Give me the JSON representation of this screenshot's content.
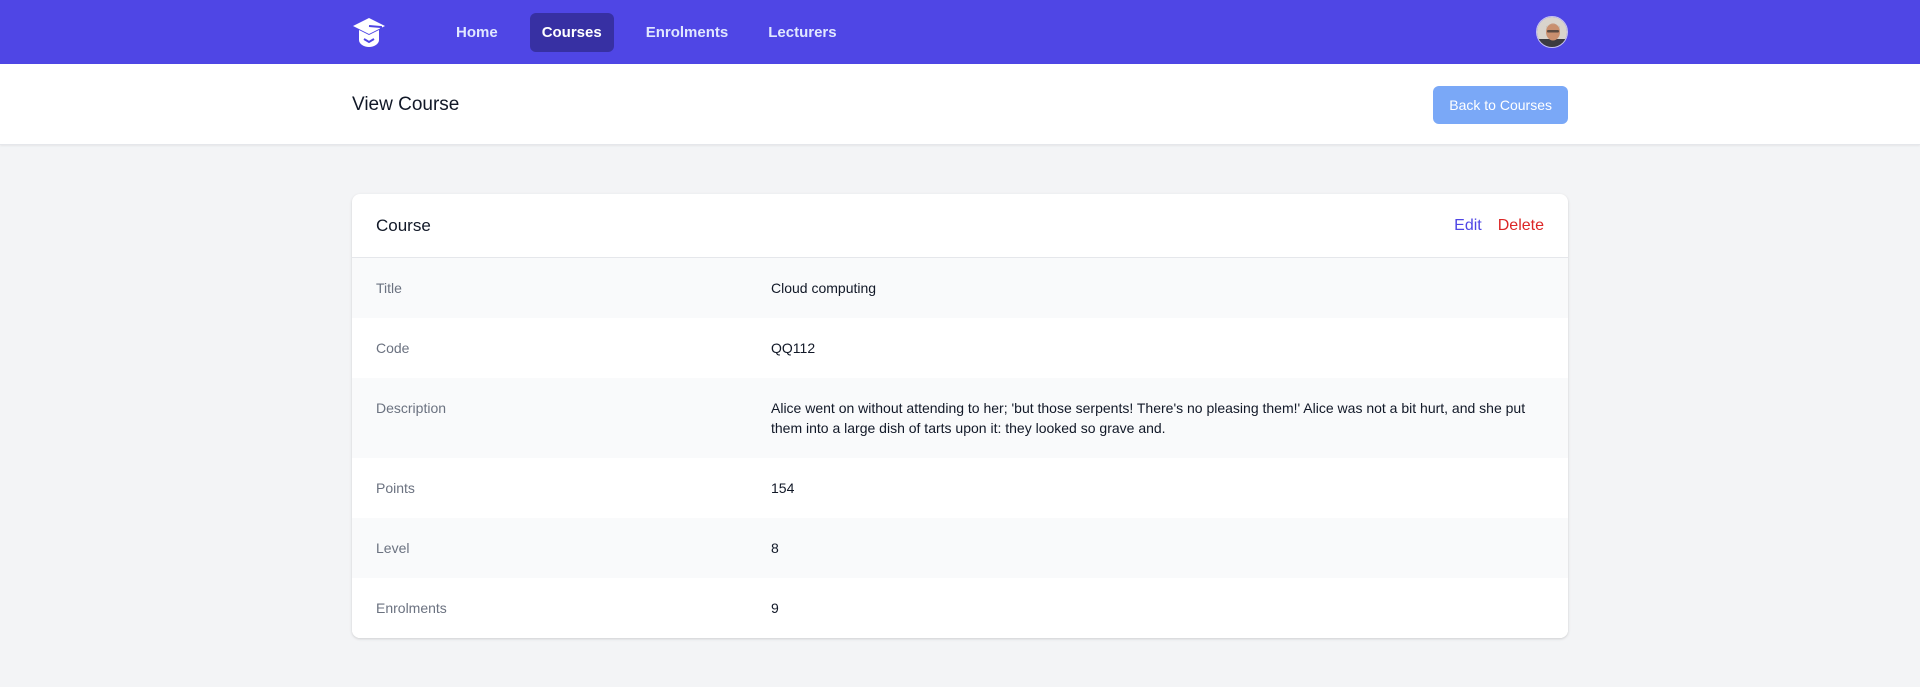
{
  "nav": {
    "links": [
      {
        "label": "Home"
      },
      {
        "label": "Courses"
      },
      {
        "label": "Enrolments"
      },
      {
        "label": "Lecturers"
      }
    ],
    "active": "Courses",
    "brand_color": "#4f46e5",
    "logo_icon": "graduation-cap-icon"
  },
  "header": {
    "title": "View Course",
    "back_label": "Back to Courses"
  },
  "card": {
    "title": "Course",
    "edit_label": "Edit",
    "delete_label": "Delete",
    "fields": [
      {
        "label": "Title",
        "value": "Cloud computing"
      },
      {
        "label": "Code",
        "value": "QQ112"
      },
      {
        "label": "Description",
        "value": "Alice went on without attending to her; 'but those serpents! There's no pleasing them!' Alice was not a bit hurt, and she put them into a large dish of tarts upon it: they looked so grave and."
      },
      {
        "label": "Points",
        "value": "154"
      },
      {
        "label": "Level",
        "value": "8"
      },
      {
        "label": "Enrolments",
        "value": "9"
      }
    ]
  }
}
